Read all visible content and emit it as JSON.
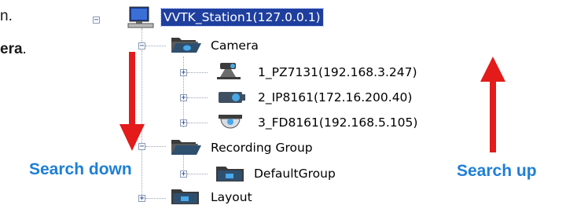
{
  "fragment": {
    "line1_end": "n.",
    "line2_bold": "era",
    "line2_end": "."
  },
  "tree": {
    "root": "VVTK_Station1(127.0.0.1)",
    "camera": "Camera",
    "cam1": "1_PZ7131(192.168.3.247)",
    "cam2": "2_IP8161(172.16.200.40)",
    "cam3": "3_FD8161(192.168.5.105)",
    "recording_group": "Recording Group",
    "default_group": "DefaultGroup",
    "layout": "Layout"
  },
  "annotations": {
    "search_down": "Search down",
    "search_up": "Search up"
  },
  "colors": {
    "selection": "#1f3f9e",
    "annotation_text": "#1e7fd6",
    "arrow": "#e31b1b"
  },
  "icons": {
    "root": "computer-icon",
    "camera": "folder-open-icon",
    "cam1": "ptz-camera-icon",
    "cam2": "box-camera-icon",
    "cam3": "dome-camera-icon",
    "recording_group": "folder-open-icon",
    "default_group": "folder-icon",
    "layout": "folder-icon"
  }
}
